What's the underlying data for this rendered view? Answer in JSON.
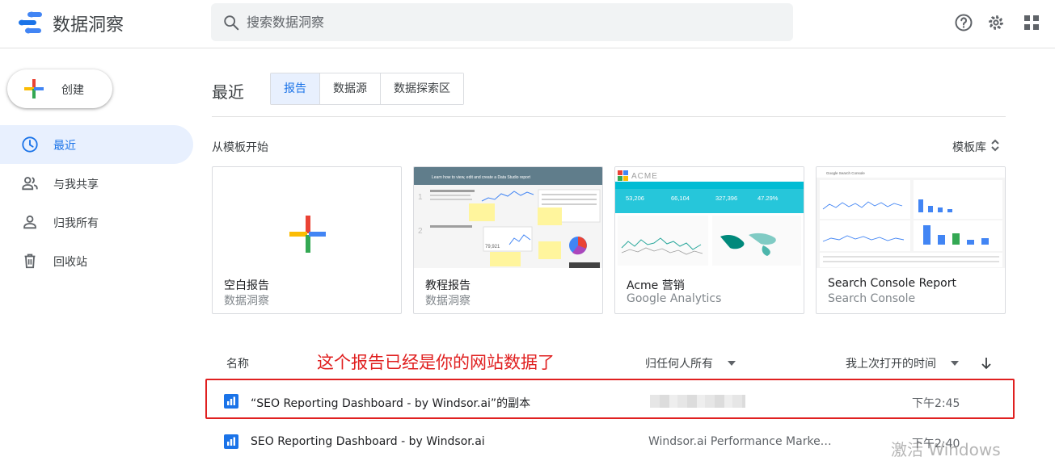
{
  "app": {
    "title": "数据洞察"
  },
  "search": {
    "placeholder": "搜索数据洞察"
  },
  "header_icons": [
    "help-icon",
    "settings-icon",
    "apps-grid-icon"
  ],
  "sidebar": {
    "create_label": "创建",
    "items": [
      {
        "label": "最近",
        "icon": "clock-icon",
        "active": true
      },
      {
        "label": "与我共享",
        "icon": "people-icon",
        "active": false
      },
      {
        "label": "归我所有",
        "icon": "person-icon",
        "active": false
      },
      {
        "label": "回收站",
        "icon": "trash-icon",
        "active": false
      }
    ]
  },
  "main": {
    "title": "最近",
    "tabs": [
      {
        "label": "报告",
        "active": true
      },
      {
        "label": "数据源",
        "active": false
      },
      {
        "label": "数据探索区",
        "active": false
      }
    ],
    "templates_label": "从模板开始",
    "gallery_label": "模板库",
    "templates": [
      {
        "title": "空白报告",
        "subtitle": "数据洞察"
      },
      {
        "title": "教程报告",
        "subtitle": "数据洞察"
      },
      {
        "title": "Acme 营销",
        "subtitle": "Google Analytics"
      },
      {
        "title": "Search Console Report",
        "subtitle": "Search Console"
      }
    ],
    "thumbnail_text": {
      "tutorial_banner": "Learn how to view, edit and create a Data Studio report",
      "acme_brand": "ACME",
      "acme_metrics": [
        "53,206",
        "66,104",
        "327,396",
        "47.29%"
      ],
      "sc_brand": "Google Search Console"
    },
    "annotation": "这个报告已经是你的网站数据了",
    "columns": {
      "name": "名称",
      "owner": "归任何人所有",
      "opened": "我上次打开的时间"
    },
    "rows": [
      {
        "name": "“SEO Reporting Dashboard - by Windsor.ai”的副本",
        "owner": "",
        "time": "下午2:45"
      },
      {
        "name": "SEO Reporting Dashboard - by Windsor.ai",
        "owner": "Windsor.ai Performance Marke…",
        "time": "下午2:40"
      }
    ]
  },
  "watermark": "激活 Windows",
  "colors": {
    "accent": "#1a73e8",
    "active_bg": "#e8f0fe",
    "annotation": "#e02020"
  }
}
